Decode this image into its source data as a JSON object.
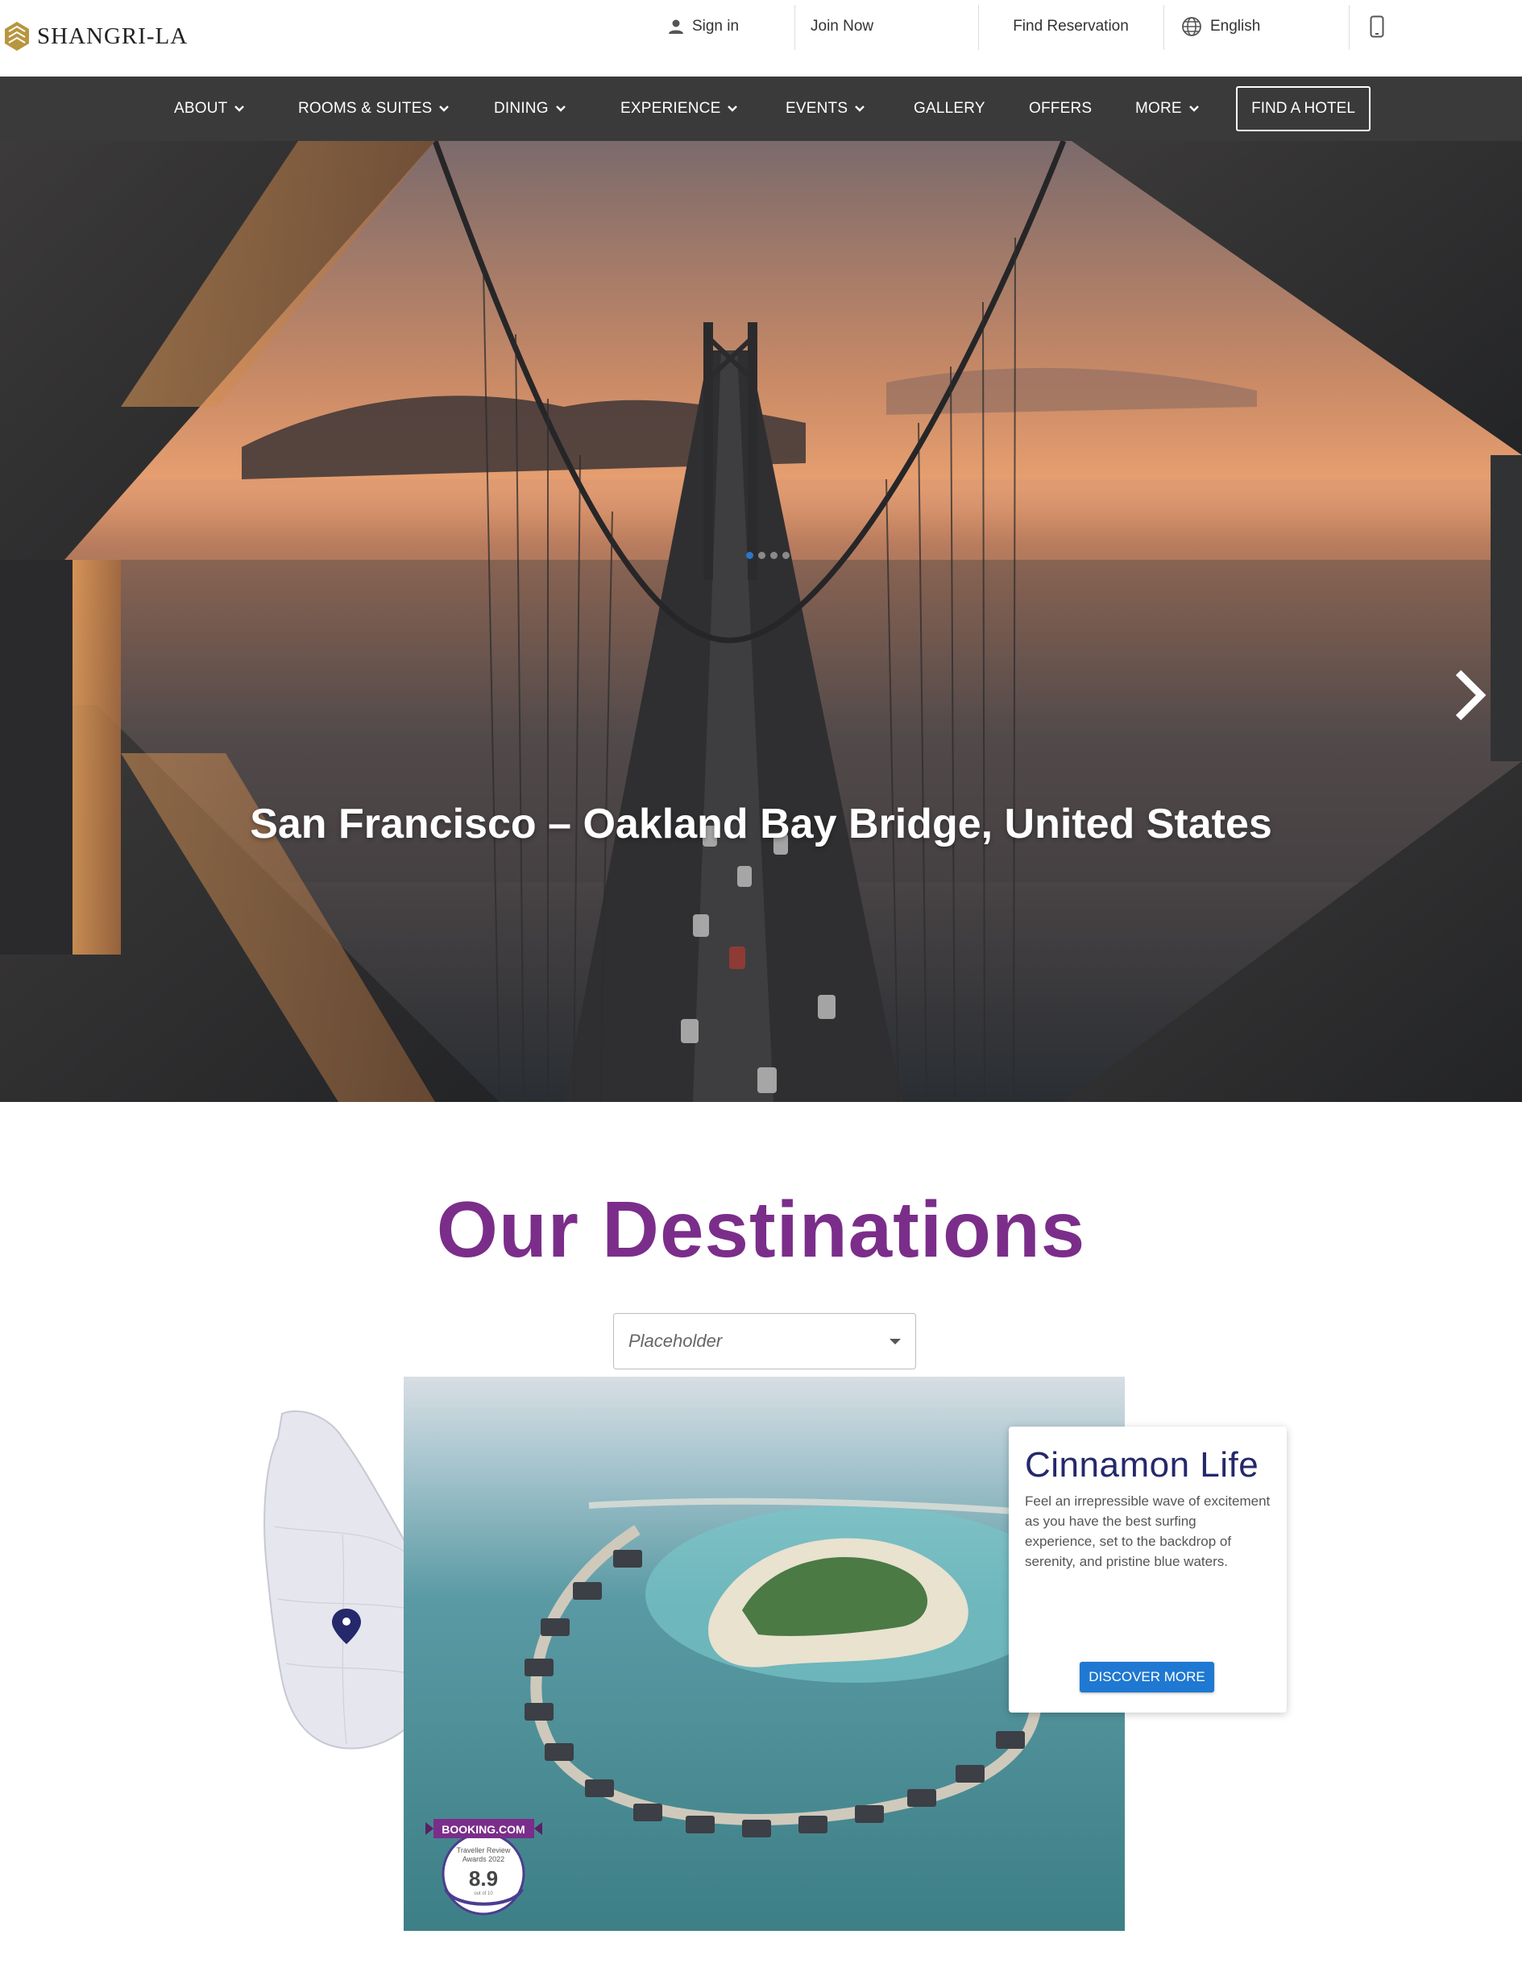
{
  "header": {
    "logo_text": "SHANGRI-LA",
    "sign_in": "Sign in",
    "join_now": "Join Now",
    "find_reservation": "Find Reservation",
    "language": "English"
  },
  "nav": {
    "items": [
      {
        "label": "ABOUT"
      },
      {
        "label": "ROOMS & SUITES"
      },
      {
        "label": "DINING"
      },
      {
        "label": "EXPERIENCE"
      },
      {
        "label": "EVENTS"
      },
      {
        "label": "GALLERY"
      },
      {
        "label": "OFFERS"
      },
      {
        "label": "MORE"
      }
    ],
    "find_hotel": "FIND A HOTEL"
  },
  "hero": {
    "caption": "San Francisco – Oakland Bay Bridge, United States",
    "slide_count": 4,
    "active_slide": 1
  },
  "destinations": {
    "title": "Our Destinations",
    "select_placeholder": "Placeholder",
    "card": {
      "title": "Cinnamon Life",
      "description": "Feel an irrepressible wave of excitement as you have the best surfing experience, set to the backdrop of serenity, and pristine blue waters.",
      "button": "DISCOVER MORE"
    },
    "badge": {
      "brand": "BOOKING.COM",
      "line1": "Traveller Review",
      "line2": "Awards 2022",
      "score": "8.9",
      "scale": "out of 10"
    }
  },
  "colors": {
    "nav_bg": "#3a3a3a",
    "title_purple": "#7b2d8a",
    "card_navy": "#25286b",
    "button_blue": "#1f78d1",
    "logo_gold": "#b8963e"
  }
}
